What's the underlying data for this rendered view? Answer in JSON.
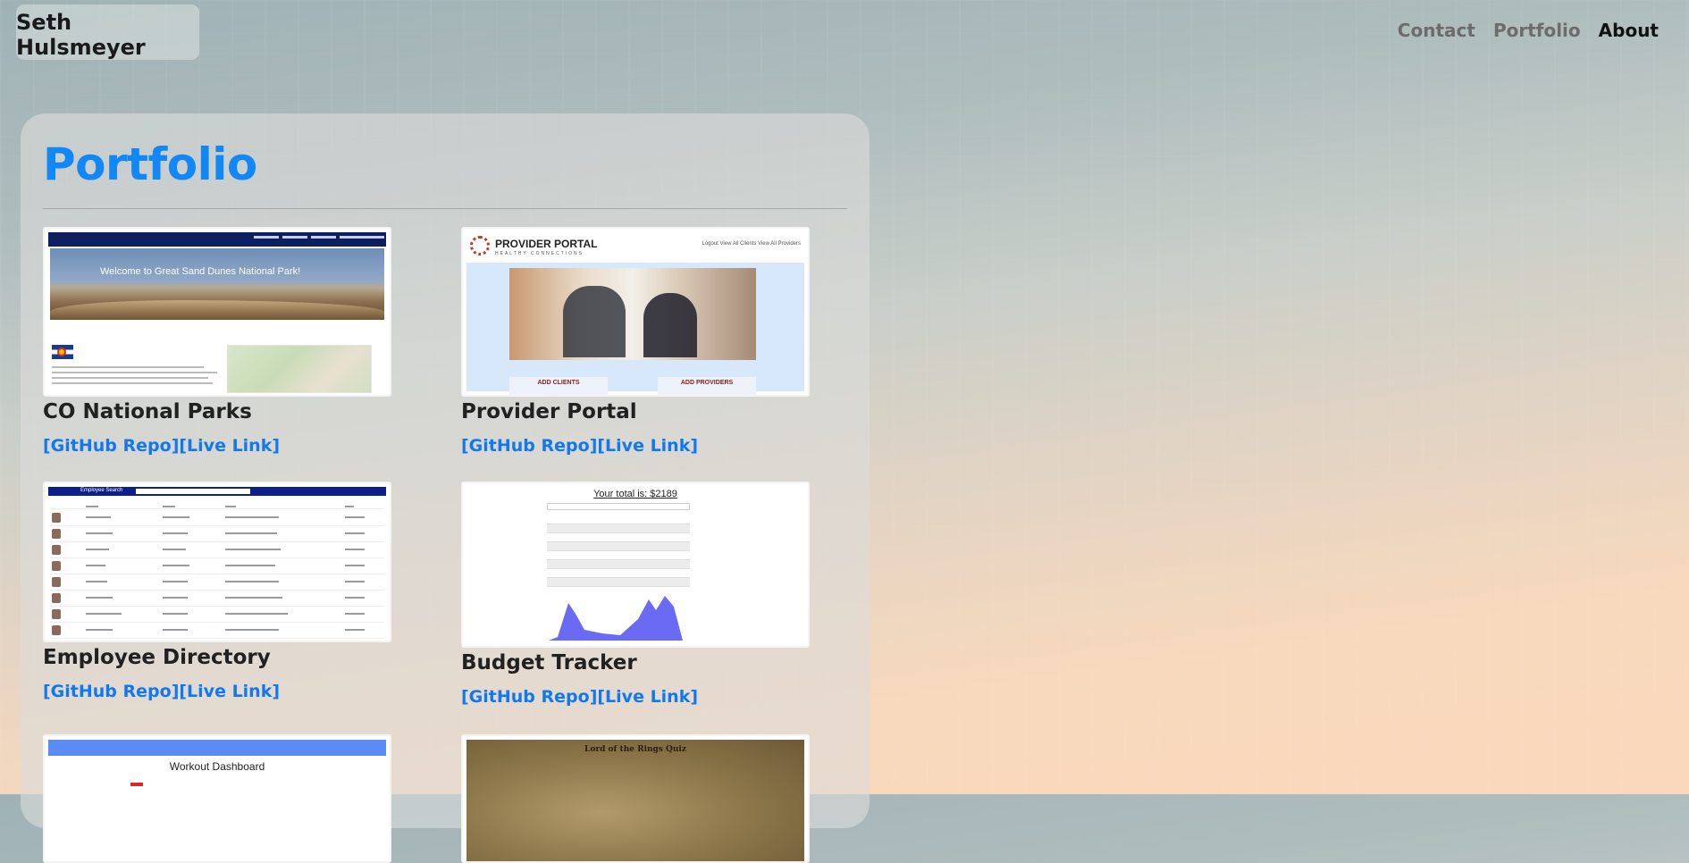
{
  "header": {
    "brand": "Seth Hulsmeyer",
    "nav": [
      {
        "label": "Contact"
      },
      {
        "label": "Portfolio"
      },
      {
        "label": "About"
      }
    ]
  },
  "main": {
    "title": "Portfolio",
    "projects": [
      {
        "title": "CO National Parks",
        "repo_label": "[GitHub Repo]",
        "live_label": "[Live Link]",
        "thumb_text": "Welcome to Great Sand Dunes National Park!"
      },
      {
        "title": "Provider Portal",
        "repo_label": "[GitHub Repo]",
        "live_label": "[Live Link]",
        "thumb_text": "PROVIDER PORTAL",
        "thumb_sub": "HEALTHY CONNECTIONS",
        "thumb_nav": "Logout  View All Clients  View All Providers",
        "btn_clients": "ADD CLIENTS",
        "btn_providers": "ADD PROVIDERS"
      },
      {
        "title": "Employee Directory",
        "repo_label": "[GitHub Repo]",
        "live_label": "[Live Link]",
        "thumb_text": "Employee Search"
      },
      {
        "title": "Budget Tracker",
        "repo_label": "[GitHub Repo]",
        "live_label": "[Live Link]",
        "thumb_text": "Your total is: $2189"
      },
      {
        "title": "",
        "thumb_text": "Workout Dashboard"
      },
      {
        "title": "",
        "thumb_text": "Lord of the Rings Quiz"
      }
    ]
  }
}
